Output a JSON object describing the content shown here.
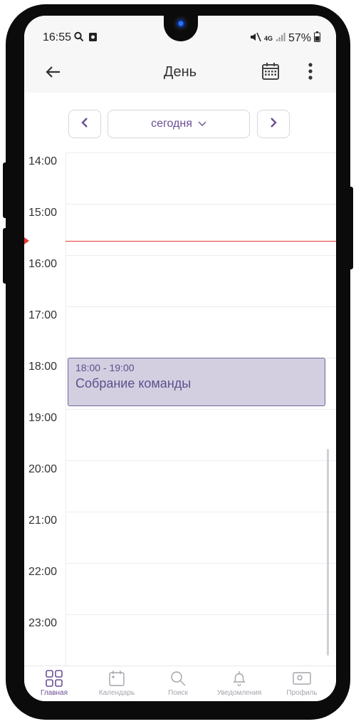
{
  "status_bar": {
    "time": "16:55",
    "network": "4G",
    "battery": "57%"
  },
  "app_bar": {
    "title": "День"
  },
  "date_nav": {
    "prev_symbol": "<",
    "today_label": "сегодня",
    "next_symbol": ">"
  },
  "timeline": {
    "hours": [
      "14:00",
      "15:00",
      "16:00",
      "17:00",
      "18:00",
      "19:00",
      "20:00",
      "21:00",
      "22:00",
      "23:00"
    ],
    "events": [
      {
        "time": "18:00 - 19:00",
        "title": "Собрание команды"
      }
    ]
  },
  "bottom_nav": {
    "items": [
      {
        "label": "Главная",
        "icon": "grid-icon",
        "active": true
      },
      {
        "label": "Календарь",
        "icon": "calendar-icon",
        "active": false
      },
      {
        "label": "Поиск",
        "icon": "search-icon",
        "active": false
      },
      {
        "label": "Уведомления",
        "icon": "bell-icon",
        "active": false
      },
      {
        "label": "Профиль",
        "icon": "profile-card-icon",
        "active": false
      }
    ]
  },
  "colors": {
    "accent": "#6a4f93",
    "event_bg": "#d3cfe1",
    "now_line": "#e53935"
  }
}
